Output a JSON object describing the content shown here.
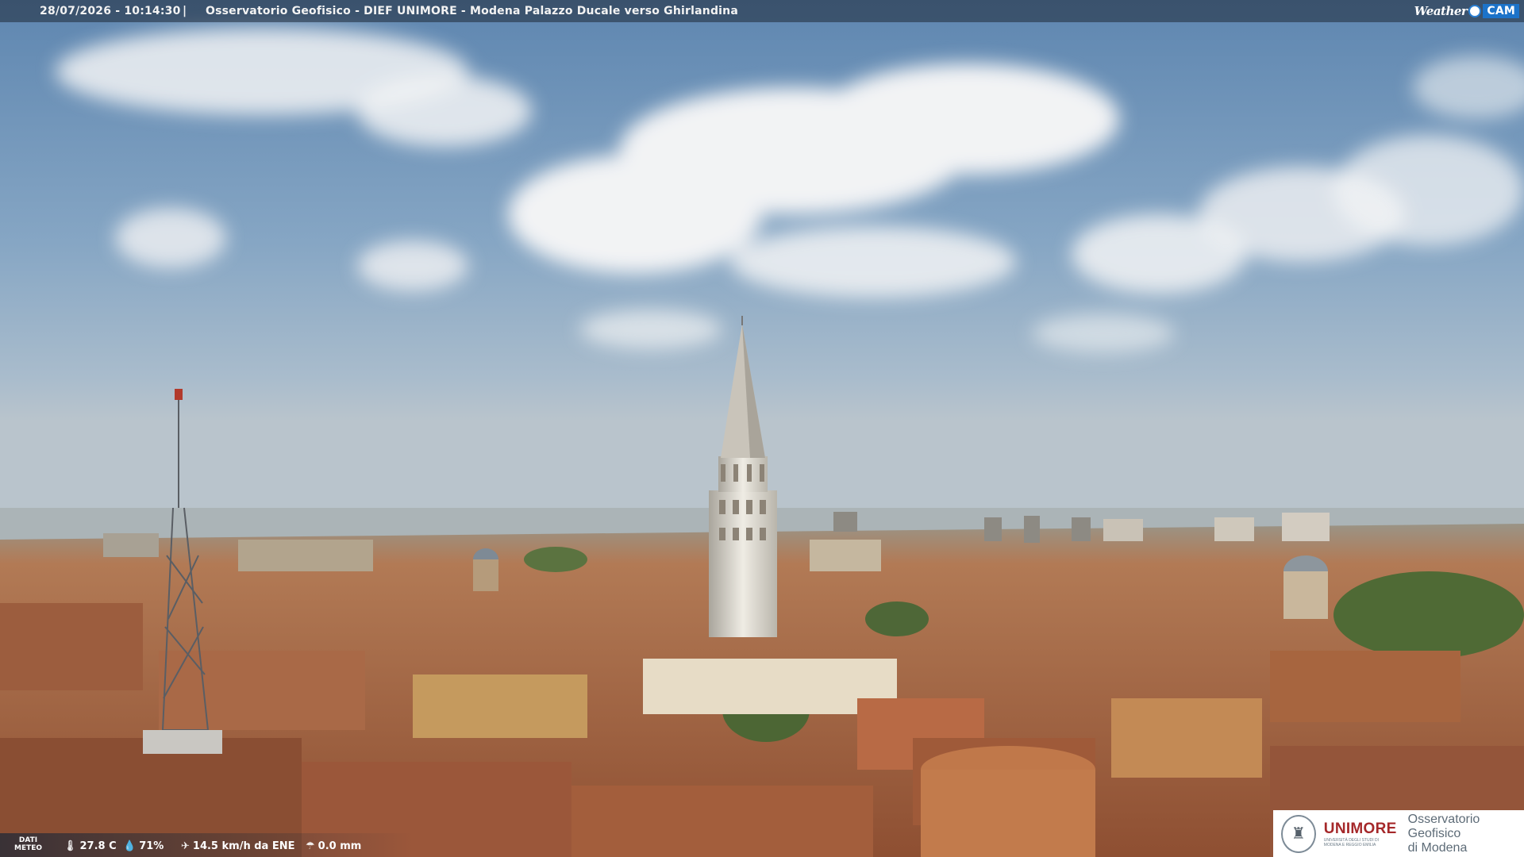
{
  "header": {
    "datetime": "28/07/2026 - 10:14:30",
    "separator": "|",
    "title": "Osservatorio Geofisico - DIEF UNIMORE - Modena Palazzo Ducale verso Ghirlandina",
    "brand_weather": "Weather",
    "brand_cam": "CAM"
  },
  "weather": {
    "label_line1": "DATI",
    "label_line2": "METEO",
    "temperature": "27.8 C",
    "humidity": "71%",
    "wind": "14.5 km/h da ENE",
    "rain": "0.0 mm",
    "icons": [
      "thermometer-icon",
      "humidity-drop-icon",
      "wind-icon",
      "rain-icon"
    ]
  },
  "logo": {
    "uni_prefix": "UNI",
    "uni_suffix": "MORE",
    "uni_subline1": "UNIVERSITÀ DEGLI STUDI DI",
    "uni_subline2": "MODENA E REGGIO EMILIA",
    "observatory_line1": "Osservatorio Geofisico",
    "observatory_line2": "di Modena",
    "brand_color": "#a5282a"
  }
}
